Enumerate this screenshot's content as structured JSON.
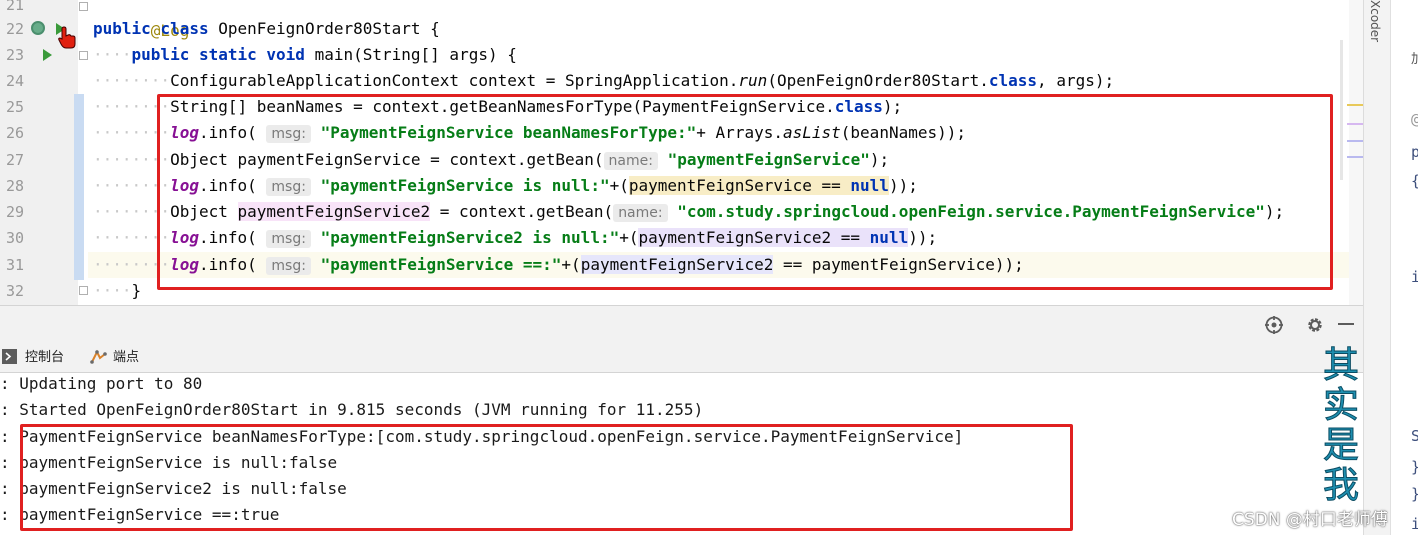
{
  "editor": {
    "line_numbers": [
      "21",
      "22",
      "23",
      "24",
      "25",
      "26",
      "27",
      "28",
      "29",
      "30",
      "31",
      "32"
    ],
    "lines": [
      {
        "annotation": "@Log"
      },
      {
        "t1": "public",
        "t2": "class",
        "t3": " OpenFeignOrder80Start {"
      },
      {
        "t1": "public",
        "t2": "static",
        "t3": "void",
        "t4": " main(String[] args) {"
      },
      {
        "a": "ConfigurableApplicationContext context = SpringApplication.",
        "b": "run",
        "c": "(OpenFeignOrder80Start.",
        "d": "class",
        "e": ", args);"
      },
      {
        "a": "String[] beanNames = context.getBeanNamesForType(PaymentFeignService.",
        "d": "class",
        "e": ");"
      },
      {
        "fld": "log",
        "a": ".info(",
        "hint": "msg:",
        "str": "\"PaymentFeignService beanNamesForType:\"",
        "b": "+ Arrays.",
        "c": "asList",
        "e": "(beanNames));"
      },
      {
        "a": "Object paymentFeignService = context.getBean(",
        "hint": "name:",
        "str": "\"paymentFeignService\"",
        "e": ");"
      },
      {
        "fld": "log",
        "a": ".info(",
        "hint": "msg:",
        "str": "\"paymentFeignService is null:\"",
        "b": "+(",
        "hl": "paymentFeignService == ",
        "kw": "null",
        "e": "));"
      },
      {
        "a": "Object ",
        "pink": "paymentFeignService2",
        "b": " = context.getBean(",
        "hint": "name:",
        "str": "\"com.study.springcloud.openFeign.service.PaymentFeignService\"",
        "e": ");"
      },
      {
        "fld": "log",
        "a": ".info(",
        "hint": "msg:",
        "str": "\"paymentFeignService2 is null:\"",
        "b": "+(",
        "hl": "paymentFeignService2",
        "c": " == ",
        "kw": "null",
        "e": "));"
      },
      {
        "fld": "log",
        "a": ".info(",
        "hint": "msg:",
        "str": "\"paymentFeignService ==:\"",
        "b": "+(",
        "hl": "paymentFeignService2",
        "e": " == paymentFeignService));"
      },
      {
        "a": "}"
      }
    ]
  },
  "console": {
    "tabs": [
      {
        "label": "控制台",
        "icon": "console-icon"
      },
      {
        "label": "端点",
        "icon": "endpoints-icon"
      }
    ],
    "toolbar_icons": [
      "globe-icon",
      "gear-icon",
      "minimize-icon"
    ],
    "lines": [
      ": Updating port to 80",
      ": Started OpenFeignOrder80Start in 9.815 seconds (JVM running for 11.255)",
      ": PaymentFeignService beanNamesForType:[com.study.springcloud.openFeign.service.PaymentFeignService]",
      ": paymentFeignService is null:false",
      ": paymentFeignService2 is null:false",
      ": paymentFeignService ==:true"
    ]
  },
  "side": {
    "vertical_label": "Xcoder",
    "decorative_text": "其实是我",
    "watermark": "CSDN @村口老师傅",
    "edge_chars": [
      "加",
      "@",
      "p",
      "{",
      "i",
      "S",
      "}",
      "}",
      "i"
    ]
  },
  "colors": {
    "keyword": "#0033b3",
    "string": "#067d17",
    "field": "#871094",
    "annotation_box": "#e02020"
  }
}
